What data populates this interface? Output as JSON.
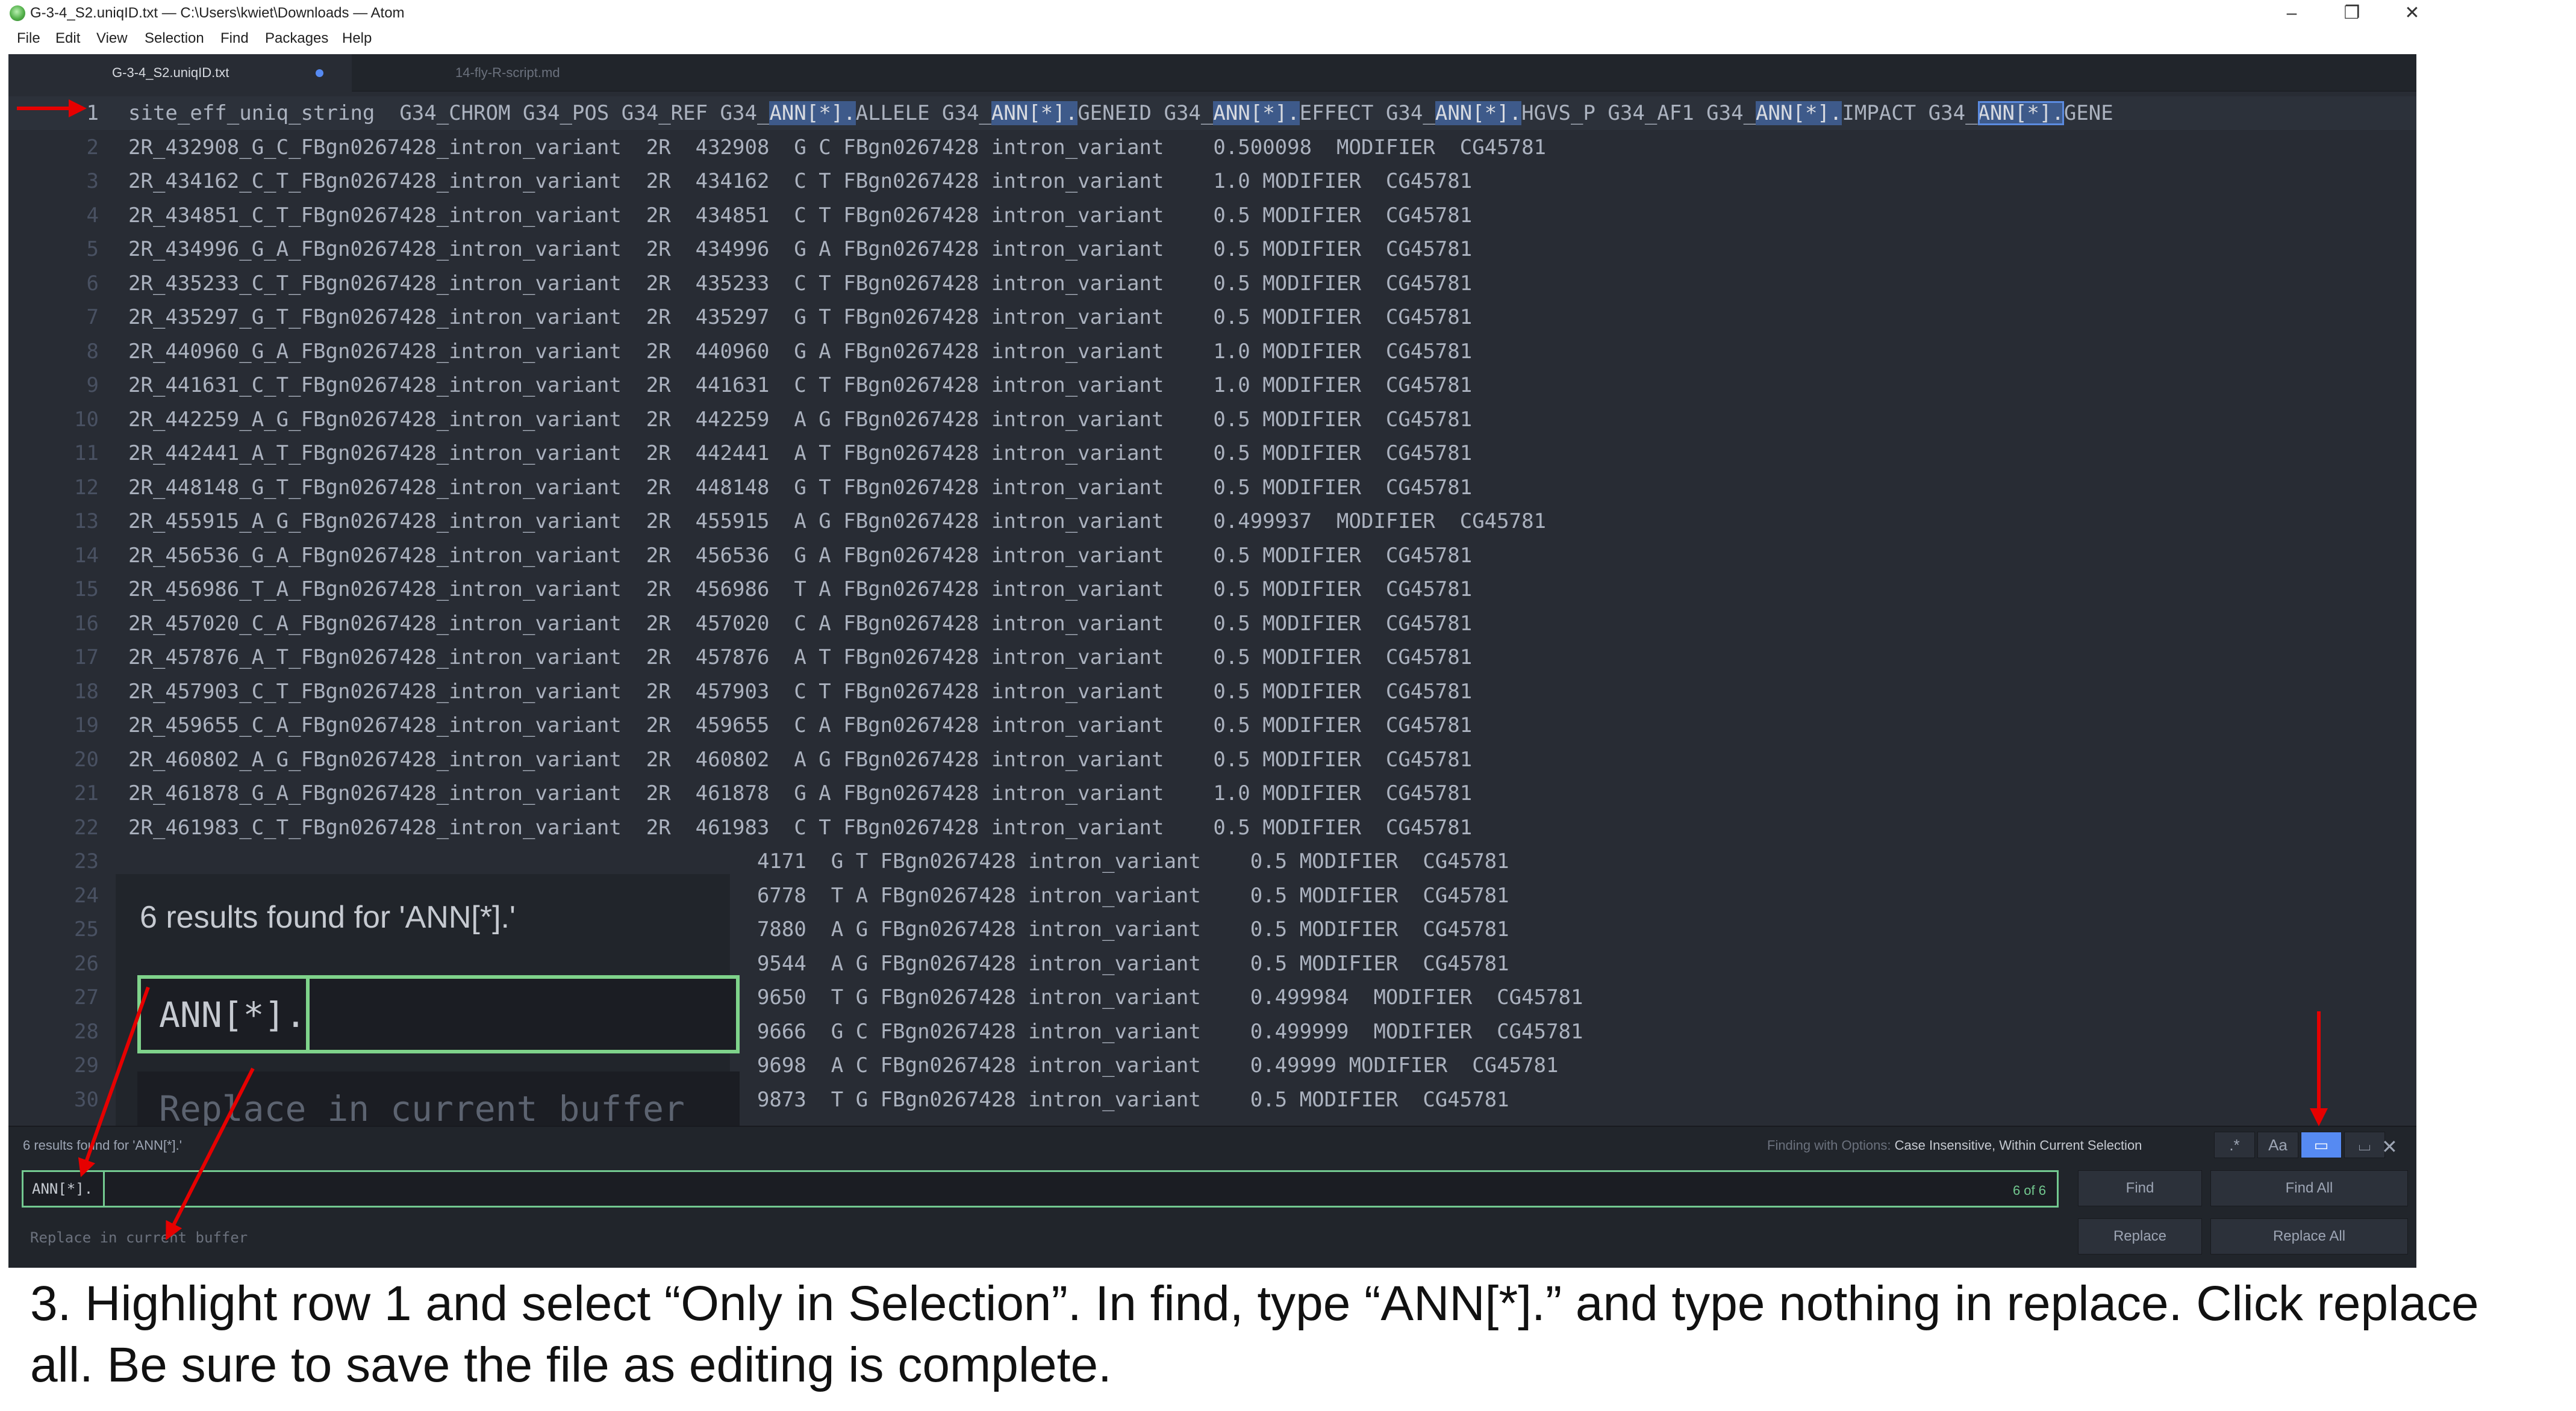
{
  "window": {
    "title": "G-3-4_S2.uniqID.txt — C:\\Users\\kwiet\\Downloads — Atom",
    "minimize_glyph": "–",
    "restore_glyph": "❐",
    "close_glyph": "✕"
  },
  "menu": [
    "File",
    "Edit",
    "View",
    "Selection",
    "Find",
    "Packages",
    "Help"
  ],
  "tabs": [
    {
      "label": "G-3-4_S2.uniqID.txt",
      "active": true,
      "modified": true
    },
    {
      "label": "14-fly-R-script.md",
      "active": false,
      "modified": false
    }
  ],
  "editor": {
    "lines": [
      "site_eff_uniq_string  G34_CHROM G34_POS G34_REF G34_ANN[*].ALLELE G34_ANN[*].GENEID G34_ANN[*].EFFECT G34_ANN[*].HGVS_P G34_AF1 G34_ANN[*].IMPACT G34_ANN[*].GENE",
      "2R_432908_G_C_FBgn0267428_intron_variant  2R  432908  G C FBgn0267428 intron_variant    0.500098  MODIFIER  CG45781",
      "2R_434162_C_T_FBgn0267428_intron_variant  2R  434162  C T FBgn0267428 intron_variant    1.0 MODIFIER  CG45781",
      "2R_434851_C_T_FBgn0267428_intron_variant  2R  434851  C T FBgn0267428 intron_variant    0.5 MODIFIER  CG45781",
      "2R_434996_G_A_FBgn0267428_intron_variant  2R  434996  G A FBgn0267428 intron_variant    0.5 MODIFIER  CG45781",
      "2R_435233_C_T_FBgn0267428_intron_variant  2R  435233  C T FBgn0267428 intron_variant    0.5 MODIFIER  CG45781",
      "2R_435297_G_T_FBgn0267428_intron_variant  2R  435297  G T FBgn0267428 intron_variant    0.5 MODIFIER  CG45781",
      "2R_440960_G_A_FBgn0267428_intron_variant  2R  440960  G A FBgn0267428 intron_variant    1.0 MODIFIER  CG45781",
      "2R_441631_C_T_FBgn0267428_intron_variant  2R  441631  C T FBgn0267428 intron_variant    1.0 MODIFIER  CG45781",
      "2R_442259_A_G_FBgn0267428_intron_variant  2R  442259  A G FBgn0267428 intron_variant    0.5 MODIFIER  CG45781",
      "2R_442441_A_T_FBgn0267428_intron_variant  2R  442441  A T FBgn0267428 intron_variant    0.5 MODIFIER  CG45781",
      "2R_448148_G_T_FBgn0267428_intron_variant  2R  448148  G T FBgn0267428 intron_variant    0.5 MODIFIER  CG45781",
      "2R_455915_A_G_FBgn0267428_intron_variant  2R  455915  A G FBgn0267428 intron_variant    0.499937  MODIFIER  CG45781",
      "2R_456536_G_A_FBgn0267428_intron_variant  2R  456536  G A FBgn0267428 intron_variant    0.5 MODIFIER  CG45781",
      "2R_456986_T_A_FBgn0267428_intron_variant  2R  456986  T A FBgn0267428 intron_variant    0.5 MODIFIER  CG45781",
      "2R_457020_C_A_FBgn0267428_intron_variant  2R  457020  C A FBgn0267428 intron_variant    0.5 MODIFIER  CG45781",
      "2R_457876_A_T_FBgn0267428_intron_variant  2R  457876  A T FBgn0267428 intron_variant    0.5 MODIFIER  CG45781",
      "2R_457903_C_T_FBgn0267428_intron_variant  2R  457903  C T FBgn0267428 intron_variant    0.5 MODIFIER  CG45781",
      "2R_459655_C_A_FBgn0267428_intron_variant  2R  459655  C A FBgn0267428 intron_variant    0.5 MODIFIER  CG45781",
      "2R_460802_A_G_FBgn0267428_intron_variant  2R  460802  A G FBgn0267428 intron_variant    0.5 MODIFIER  CG45781",
      "2R_461878_G_A_FBgn0267428_intron_variant  2R  461878  G A FBgn0267428 intron_variant    1.0 MODIFIER  CG45781",
      "2R_461983_C_T_FBgn0267428_intron_variant  2R  461983  C T FBgn0267428 intron_variant    0.5 MODIFIER  CG45781",
      "                                                   4171  G T FBgn0267428 intron_variant    0.5 MODIFIER  CG45781",
      "                                                   6778  T A FBgn0267428 intron_variant    0.5 MODIFIER  CG45781",
      "                                                   7880  A G FBgn0267428 intron_variant    0.5 MODIFIER  CG45781",
      "                                                   9544  A G FBgn0267428 intron_variant    0.5 MODIFIER  CG45781",
      "                                                   9650  T G FBgn0267428 intron_variant    0.499984  MODIFIER  CG45781",
      "                                                   9666  G C FBgn0267428 intron_variant    0.499999  MODIFIER  CG45781",
      "                                                   9698  A C FBgn0267428 intron_variant    0.49999 MODIFIER  CG45781",
      "                                                   9873  T G FBgn0267428 intron_variant    0.5 MODIFIER  CG45781"
    ],
    "search_term": "ANN[*].",
    "current_match": 6,
    "current_line": 1
  },
  "zoom_callout": {
    "results_text": "6 results found for 'ANN[*].'",
    "find_value": "ANN[*].",
    "replace_placeholder": "Replace in current buffer"
  },
  "find_panel": {
    "results_text": "6 results found for 'ANN[*].'",
    "options_label": "Finding with Options:",
    "options_value": "Case Insensitive, Within Current Selection",
    "option_buttons": [
      {
        "glyph": ".*",
        "name": "regex-toggle",
        "active": false
      },
      {
        "glyph": "Aa",
        "name": "case-sensitive-toggle",
        "active": false
      },
      {
        "glyph": "▭",
        "name": "only-in-selection-toggle",
        "active": true
      },
      {
        "glyph": "⌴",
        "name": "whole-word-toggle",
        "active": false
      }
    ],
    "close_glyph": "✕",
    "find_value": "ANN[*].",
    "match_count": "6 of 6",
    "replace_placeholder": "Replace in current buffer",
    "find_label": "Find",
    "find_all_label": "Find All",
    "replace_label": "Replace",
    "replace_all_label": "Replace All"
  },
  "annotations": {
    "arrow_color": "#e60000"
  },
  "caption": "3. Highlight row 1 and select “Only in Selection”. In find, type “ANN[*].” and type nothing in replace. Click replace all. Be sure to save the file as editing is complete."
}
